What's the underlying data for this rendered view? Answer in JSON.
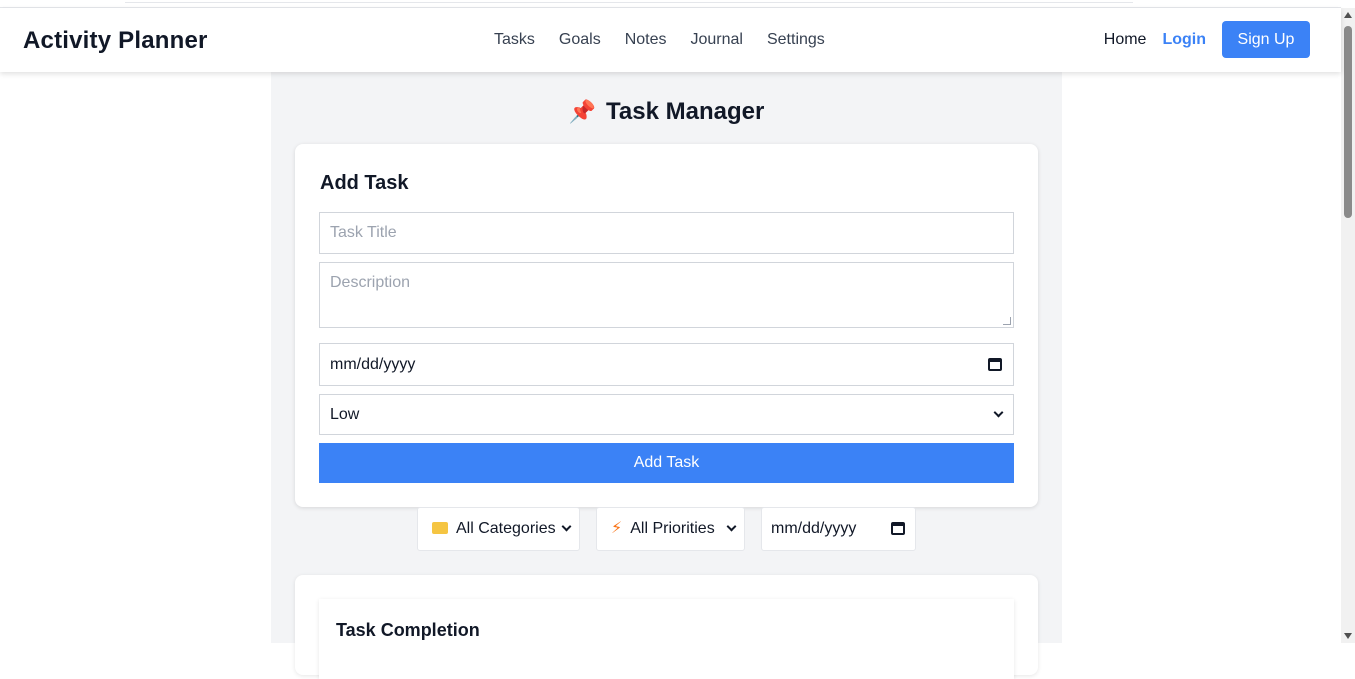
{
  "navbar": {
    "brand": "Activity Planner",
    "links": [
      "Tasks",
      "Goals",
      "Notes",
      "Journal",
      "Settings"
    ],
    "home": "Home",
    "login": "Login",
    "signup": "Sign Up"
  },
  "page": {
    "title_icon": "pushpin-icon",
    "title": "Task Manager"
  },
  "add_task": {
    "heading": "Add Task",
    "title_placeholder": "Task Title",
    "description_placeholder": "Description",
    "date_value": "mm/dd/yyyy",
    "priority_value": "Low",
    "submit_label": "Add Task"
  },
  "filters": {
    "category_icon": "folder-icon",
    "category_value": "All Categories",
    "priority_icon": "lightning-icon",
    "priority_value": "All Priorities",
    "date_value": "mm/dd/yyyy"
  },
  "completion": {
    "heading": "Task Completion"
  },
  "colors": {
    "accent": "#3b82f6",
    "background": "#f3f4f6",
    "text": "#111827"
  }
}
